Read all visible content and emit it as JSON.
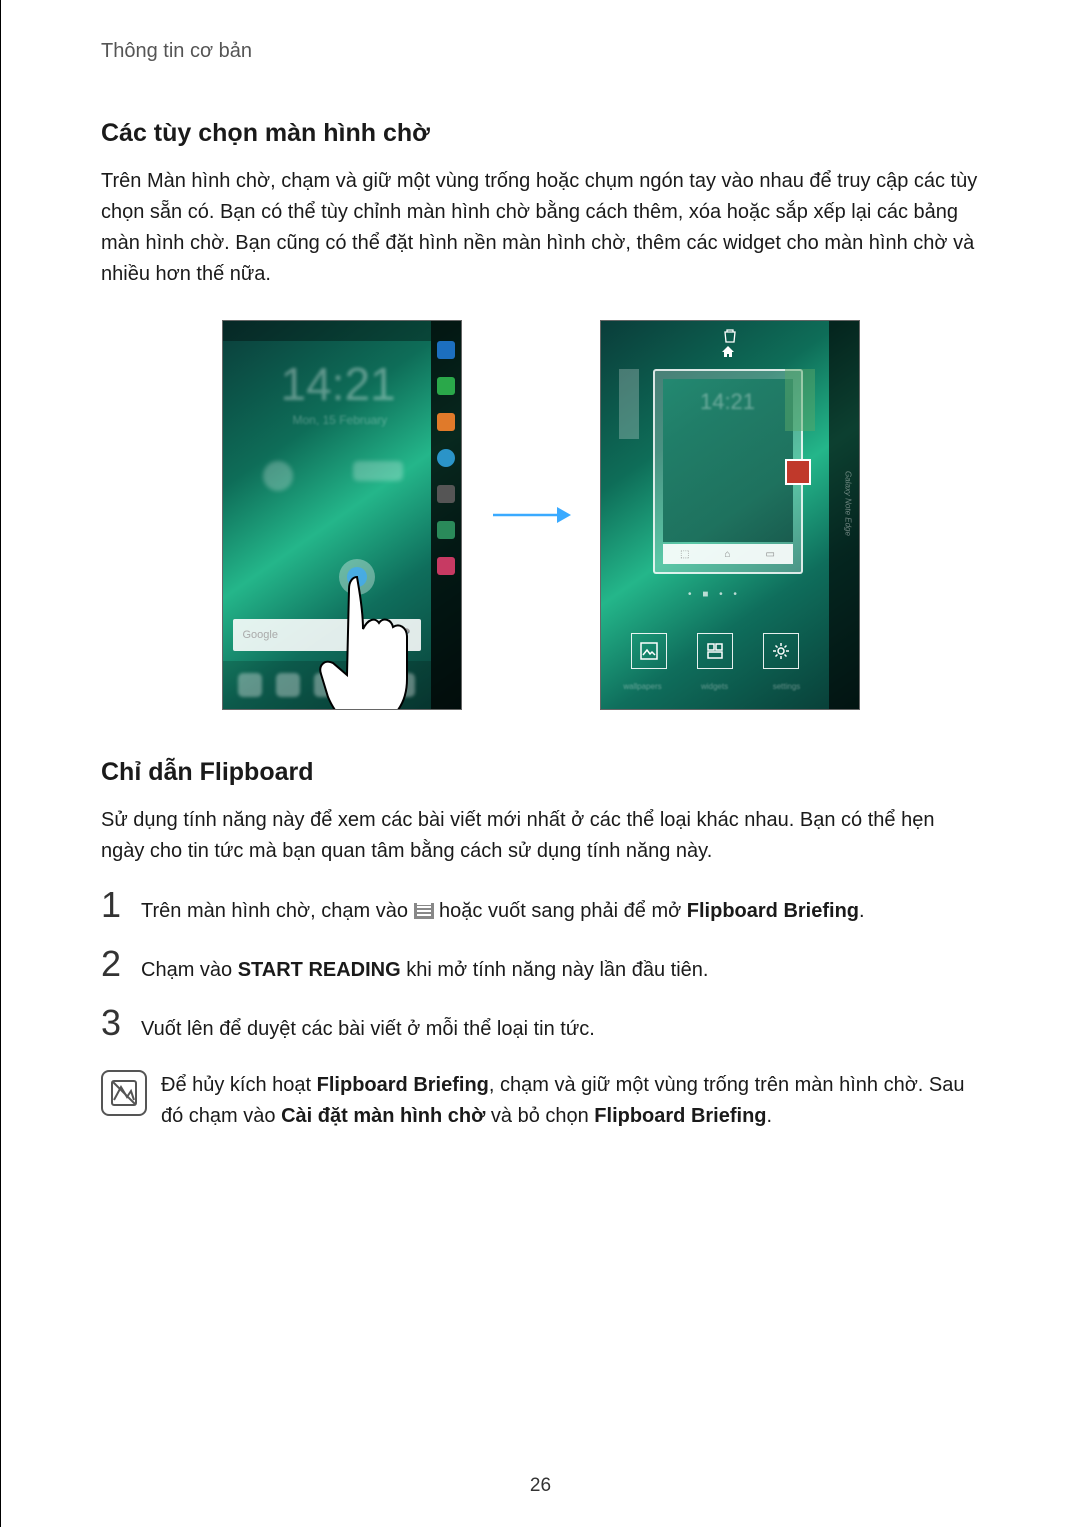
{
  "header": "Thông tin cơ bản",
  "section1": {
    "title": "Các tùy chọn màn hình chờ",
    "body": "Trên Màn hình chờ, chạm và giữ một vùng trống hoặc chụm ngón tay vào nhau để truy cập các tùy chọn sẵn có. Bạn có thể tùy chỉnh màn hình chờ bằng cách thêm, xóa hoặc sắp xếp lại các bảng màn hình chờ. Bạn cũng có thể đặt hình nền màn hình chờ, thêm các widget cho màn hình chờ và nhiều hơn thế nữa."
  },
  "figure": {
    "phone1": {
      "time": "14:21",
      "date": "Mon, 15 February",
      "search_placeholder": "Google",
      "search_mic": "🎤",
      "edge_icons": [
        {
          "name": "star-icon",
          "bg": "#1c6fbf"
        },
        {
          "name": "phone-icon",
          "bg": "#2aa84a"
        },
        {
          "name": "contacts-icon",
          "bg": "#e07a2a"
        },
        {
          "name": "browser-icon",
          "bg": "#2b94c8"
        },
        {
          "name": "camera-icon",
          "bg": "#555"
        },
        {
          "name": "store-icon",
          "bg": "#2a8a5a"
        },
        {
          "name": "apps-icon",
          "bg": "#c73a63"
        }
      ]
    },
    "arrow_color": "#3aaaff",
    "phone2": {
      "time": "14:21",
      "edge_label": "Galaxy Note Edge",
      "side_colors": [
        "#3a9a4a",
        "#6b1f8a",
        "#c7423a"
      ],
      "right_tile": "#c0392b",
      "dots": "• ■ • •",
      "editor": [
        "wallpapers",
        "widgets",
        "settings"
      ]
    }
  },
  "section2": {
    "title": "Chỉ dẫn Flipboard",
    "body": "Sử dụng tính năng này để xem các bài viết mới nhất ở các thể loại khác nhau. Bạn có thể hẹn ngày cho tin tức mà bạn quan tâm bằng cách sử dụng tính năng này."
  },
  "steps": {
    "s1a": "Trên màn hình chờ, chạm vào ",
    "s1b": " hoặc vuốt sang phải để mở ",
    "s1c": "Flipboard Briefing",
    "s1d": ".",
    "s2a": "Chạm vào ",
    "s2b": "START READING",
    "s2c": " khi mở tính năng này lần đầu tiên.",
    "s3": "Vuốt lên để duyệt các bài viết ở mỗi thể loại tin tức."
  },
  "note": {
    "a": "Để hủy kích hoạt ",
    "b": "Flipboard Briefing",
    "c": ", chạm và giữ một vùng trống trên màn hình chờ. Sau đó chạm vào ",
    "d": "Cài đặt màn hình chờ",
    "e": " và bỏ chọn ",
    "f": "Flipboard Briefing",
    "g": "."
  },
  "page_number": "26"
}
